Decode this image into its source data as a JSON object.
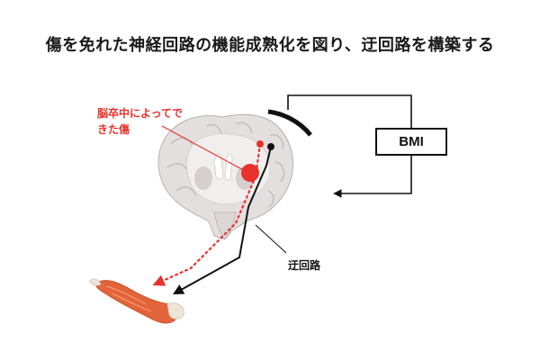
{
  "title": "傷を免れた神経回路の機能成熟化を図り、迂回路を構築する",
  "labels": {
    "lesion": "脳卒中によってできた傷",
    "bmi": "BMI",
    "bypass": "迂回路"
  },
  "colors": {
    "lesion_red": "#e8322c",
    "pathway_black": "#111111",
    "brain_gray": "#d8d3d3",
    "muscle_orange": "#e2643a"
  }
}
